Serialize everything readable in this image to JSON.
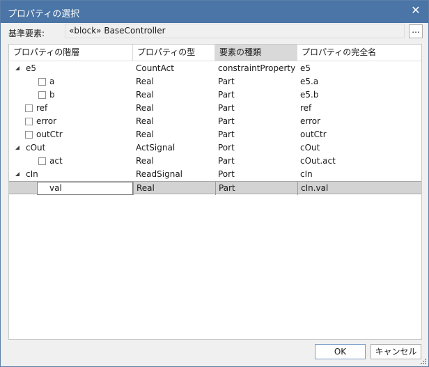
{
  "window": {
    "title": "プロパティの選択",
    "close_glyph": "✕"
  },
  "base": {
    "label": "基準要素:",
    "value": "«block» BaseController",
    "browse_label": "..."
  },
  "grid": {
    "columns": [
      "プロパティの階層",
      "プロパティの型",
      "要素の種類",
      "プロパティの完全名"
    ],
    "sorted_column": 2,
    "rows": [
      {
        "name": "e5",
        "type": "CountAct",
        "kind": "constraintProperty",
        "full": "e5",
        "level": 0,
        "expander": "expanded",
        "checkbox": false
      },
      {
        "name": "a",
        "type": "Real",
        "kind": "Part",
        "full": "e5.a",
        "level": 1,
        "checkbox": true,
        "checked": false
      },
      {
        "name": "b",
        "type": "Real",
        "kind": "Part",
        "full": "e5.b",
        "level": 1,
        "checkbox": true,
        "checked": false
      },
      {
        "name": "ref",
        "type": "Real",
        "kind": "Part",
        "full": "ref",
        "level": 0,
        "checkbox": true,
        "checked": false
      },
      {
        "name": "error",
        "type": "Real",
        "kind": "Part",
        "full": "error",
        "level": 0,
        "checkbox": true,
        "checked": false
      },
      {
        "name": "outCtr",
        "type": "Real",
        "kind": "Part",
        "full": "outCtr",
        "level": 0,
        "checkbox": true,
        "checked": false
      },
      {
        "name": "cOut",
        "type": "ActSignal",
        "kind": "Port",
        "full": "cOut",
        "level": 0,
        "expander": "expanded",
        "checkbox": false
      },
      {
        "name": "act",
        "type": "Real",
        "kind": "Part",
        "full": "cOut.act",
        "level": 1,
        "checkbox": true,
        "checked": false
      },
      {
        "name": "cIn",
        "type": "ReadSignal",
        "kind": "Port",
        "full": "cIn",
        "level": 0,
        "expander": "expanded",
        "checkbox": false
      },
      {
        "name": "val",
        "type": "Real",
        "kind": "Part",
        "full": "cIn.val",
        "level": 1,
        "checkbox": true,
        "checked": true,
        "selected": true
      }
    ]
  },
  "buttons": {
    "ok": "OK",
    "cancel": "キャンセル"
  },
  "colors": {
    "titlebar": "#4a75a6",
    "selected_row": "#d3d3d3"
  }
}
